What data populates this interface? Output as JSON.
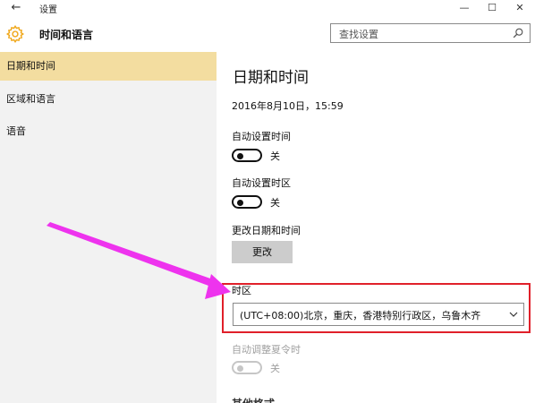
{
  "window": {
    "title": "设置",
    "back_glyph": "←",
    "minimize_glyph": "—",
    "maximize_glyph": "☐",
    "close_glyph": "✕"
  },
  "header": {
    "title": "时间和语言",
    "search_placeholder": "查找设置",
    "icon": "gear-icon",
    "accent_color": "#f0a81c"
  },
  "sidebar": {
    "items": [
      {
        "label": "日期和时间",
        "active": true
      },
      {
        "label": "区域和语言",
        "active": false
      },
      {
        "label": "语音",
        "active": false
      }
    ]
  },
  "main": {
    "title": "日期和时间",
    "datetime": "2016年8月10日，15:59",
    "auto_time": {
      "label": "自动设置时间",
      "state": "关"
    },
    "auto_timezone": {
      "label": "自动设置时区",
      "state": "关"
    },
    "change_datetime": {
      "label": "更改日期和时间",
      "button": "更改"
    },
    "timezone": {
      "label": "时区",
      "value": "(UTC+08:00)北京，重庆，香港特别行政区，乌鲁木齐"
    },
    "dst": {
      "label": "自动调整夏令时",
      "state": "关"
    },
    "next_section": "其他格式"
  },
  "annotation": {
    "arrow_color": "#ee33ee",
    "highlight_color": "#e0202a"
  }
}
